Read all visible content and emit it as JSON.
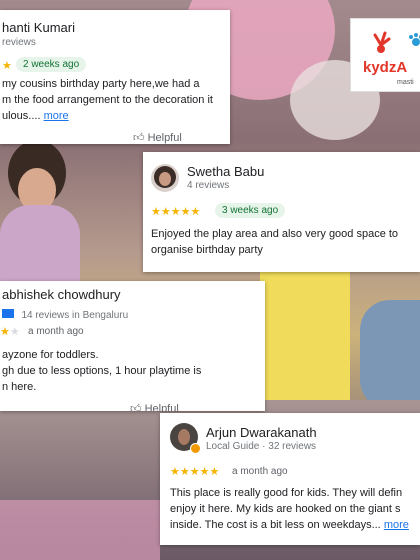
{
  "brand": {
    "logo_text": "kydzA",
    "logo_tagline": "masti"
  },
  "reviews": [
    {
      "name": "hanti Kumari",
      "sub": "reviews",
      "stars": 1,
      "date": "2 weeks ago",
      "lines": [
        "my cousins birthday party here,we had a",
        "m the food arrangement to the decoration it",
        "ulous...."
      ],
      "more": "more",
      "helpful": "Helpful"
    },
    {
      "name": "Swetha Babu",
      "sub": "4 reviews",
      "stars": 5,
      "date": "3 weeks ago",
      "lines": [
        "Enjoyed the play area and also very good space to",
        "organise birthday party"
      ]
    },
    {
      "name": "abhishek chowdhury",
      "sub": "14 reviews in Bengaluru",
      "stars": 2,
      "date": "a month ago",
      "lines": [
        "ayzone for toddlers.",
        "gh due to less options, 1 hour playtime is",
        "n here."
      ],
      "helpful": "Helpful"
    },
    {
      "name": "Arjun Dwarakanath",
      "sub": "Local Guide · 32 reviews",
      "stars": 5,
      "date": "a month ago",
      "lines": [
        "This place is really good for kids. They will defin",
        "enjoy it here. My kids are hooked on the giant s",
        "inside. The cost is a bit less on weekdays..."
      ],
      "more": "more"
    }
  ],
  "colors": {
    "star": "#f4b400",
    "pill_bg": "#e6f4ea",
    "pill_text": "#137333",
    "link": "#1a73e8"
  }
}
